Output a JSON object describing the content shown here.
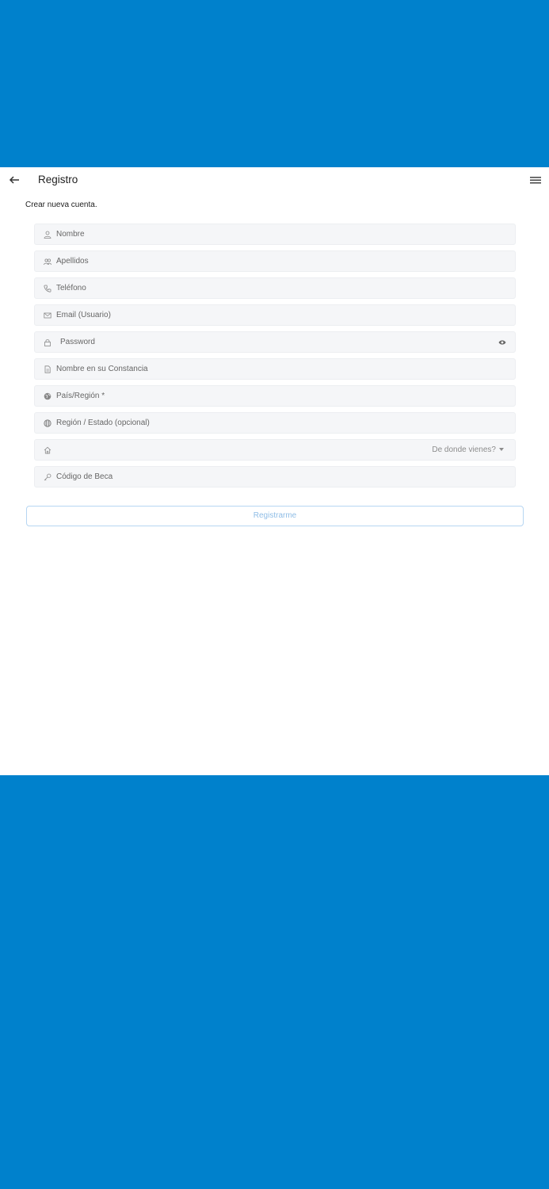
{
  "appbar": {
    "title": "Registro"
  },
  "form": {
    "subtitle": "Crear nueva cuenta.",
    "fields": {
      "nombre": "Nombre",
      "apellidos": "Apellidos",
      "telefono": "Teléfono",
      "email": "Email (Usuario)",
      "password": "Password",
      "constancia": "Nombre en su Constancia",
      "pais": "País/Región *",
      "region": "Región / Estado (opcional)",
      "origen_select": "De donde vienes?",
      "beca": "Código de Beca"
    },
    "submit_label": "Registrarme"
  },
  "colors": {
    "accent": "#0081cc",
    "button_text": "#8fbde6"
  }
}
